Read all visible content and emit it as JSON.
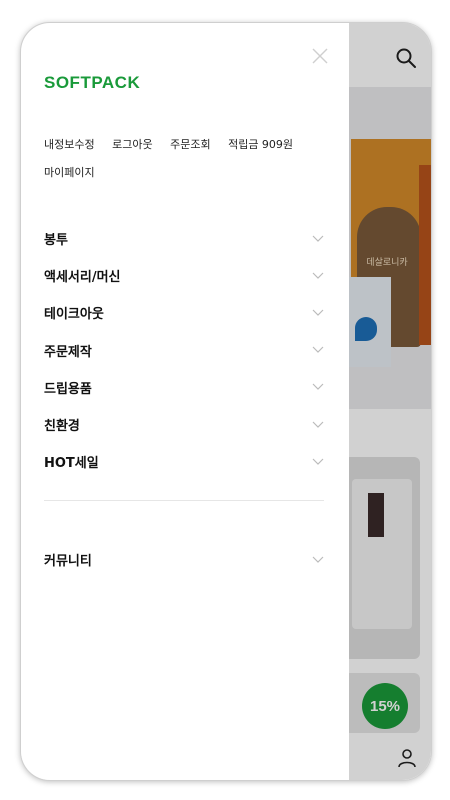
{
  "drawer": {
    "logo": "SOFTPACK",
    "util_links": [
      "내정보수정",
      "로그아웃",
      "주문조회",
      "적립금 909원",
      "마이페이지"
    ],
    "menu": [
      "봉투",
      "액세서리/머신",
      "테이크아웃",
      "주문제작",
      "드립용품",
      "친환경",
      "HOT세일"
    ],
    "community": "커뮤니티"
  },
  "background": {
    "pouch_label": "데살로니카",
    "discount_badge": "15%"
  },
  "colors": {
    "brand_green": "#1a9a3a",
    "overlay": "rgba(0,0,0,0.18)"
  },
  "icons": [
    "search-icon",
    "close-icon",
    "chevron-down-icon",
    "user-icon"
  ]
}
